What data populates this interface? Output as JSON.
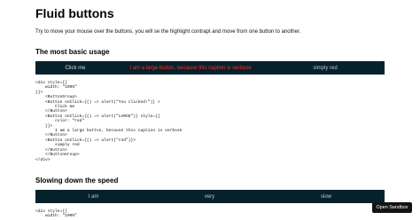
{
  "title": "Fluid buttons",
  "intro": "Try to move your mouse over the buttons, you will se the highlight contrapt and move from one button to another.",
  "section1": {
    "heading": "The most basic usage",
    "buttons": [
      {
        "label": "Click me"
      },
      {
        "label": "I am a large button, because this caption is verbose"
      },
      {
        "label": "simply red"
      }
    ],
    "code": "<div style={{\n    width: \"100%\"\n}}>\n    <ButtonGroup>\n    <Button onClick={() => alert(\"You clicked!\")} >\n        Click me\n    </Button>\n    <Button onClick={() => alert(\"LARGE\")} style={{\n        color: \"red\"\n    }}>\n        I am a large button, because this caption is verbose\n    </Button>\n    <Button onClick={() => alert(\"red\")}>\n        simply red\n    </Button>\n    </ButtonGroup>\n</div>"
  },
  "section2": {
    "heading": "Slowing down the speed",
    "buttons": [
      {
        "label": "I am"
      },
      {
        "label": "very"
      },
      {
        "label": "slow"
      }
    ],
    "code": "<div style={{\n    width: \"100%\""
  },
  "sandbox_label": "Open Sandbox",
  "colors": {
    "button_bar": "#05222c",
    "button_text": "#d8d8d8",
    "red_text": "#ff2b2b"
  }
}
